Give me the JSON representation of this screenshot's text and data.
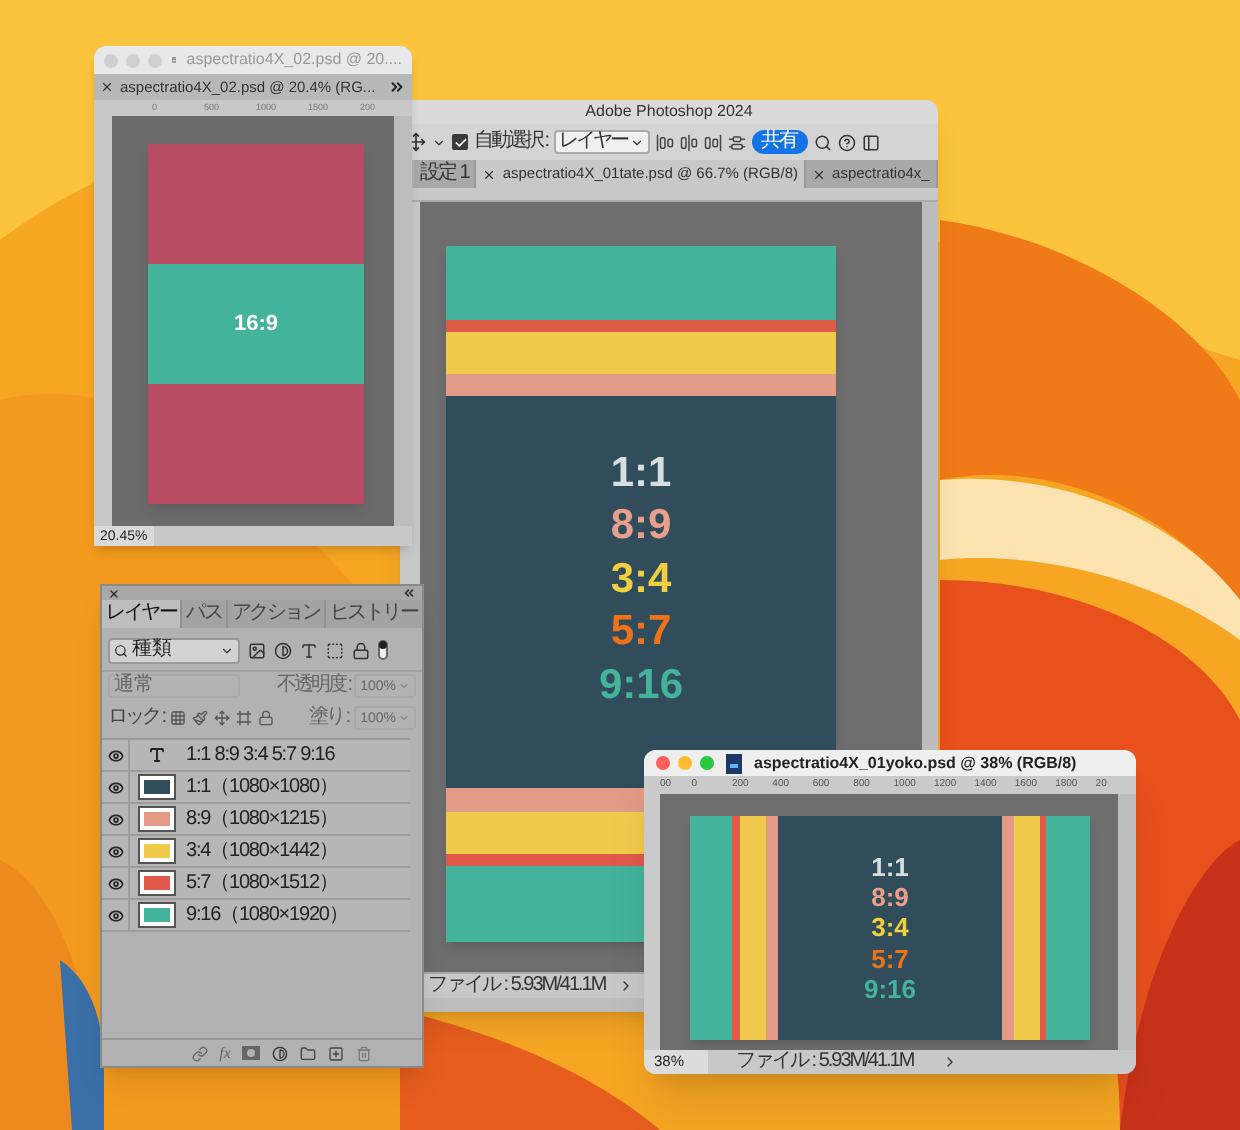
{
  "window_02": {
    "active": false,
    "title": "aspectratio4X_02.psd @ 20....",
    "tab": {
      "label": "aspectratio4X_02.psd @ 20.4% (RG...",
      "selected": true
    },
    "ruler": [
      "0",
      "500",
      "1000",
      "1500",
      "200"
    ],
    "bands": [
      {
        "color": "#b84c62"
      },
      {
        "color": "#44b39b",
        "label": "16:9"
      },
      {
        "color": "#b84c62"
      }
    ],
    "zoom": "20.45%"
  },
  "photoshop_window": {
    "title": "Adobe Photoshop 2024",
    "auto_select": {
      "label": "自動選択 :",
      "checked": true
    },
    "target": "レイヤー",
    "share_button": "共有",
    "tabs": [
      {
        "label": "設定 1",
        "selected": false
      },
      {
        "label": "aspectratio4X_01tate.psd @ 66.7% (RGB/8)",
        "selected": true
      },
      {
        "label": "aspectratio4x_",
        "selected": false
      }
    ],
    "stripes_top": [
      {
        "color": "#44b39b"
      },
      {
        "color": "#e05a4a"
      },
      {
        "color": "#f0cb4b"
      },
      {
        "color": "#e39a87"
      }
    ],
    "ratios": [
      {
        "text": "1:1",
        "color": "#d8dde0"
      },
      {
        "text": "8:9",
        "color": "#e8a08c"
      },
      {
        "text": "3:4",
        "color": "#f2cf3f"
      },
      {
        "text": "5:7",
        "color": "#ee7318"
      },
      {
        "text": "9:16",
        "color": "#44b39b"
      }
    ],
    "stripes_bottom": [
      {
        "color": "#e39a87"
      },
      {
        "color": "#f0cb4b"
      },
      {
        "color": "#e05a4a"
      },
      {
        "color": "#44b39b"
      }
    ],
    "file_info": "ファイル : 5.93M/41.1M"
  },
  "layers_panel": {
    "tabs": [
      {
        "label": "レイヤー",
        "selected": true
      },
      {
        "label": "パス",
        "selected": false
      },
      {
        "label": "アクション",
        "selected": false
      },
      {
        "label": "ヒストリー",
        "selected": false
      }
    ],
    "filter": "種類",
    "blend_mode": {
      "value": "通常",
      "disabled": true
    },
    "opacity": {
      "label": "不透明度 :",
      "value": "100%",
      "disabled": true
    },
    "lock_label": "ロック :",
    "fill": {
      "label": "塗り :",
      "value": "100%",
      "disabled": true
    },
    "layers": [
      {
        "kind": "text",
        "name": "1:1 8:9 3:4 5:7 9:16",
        "visible": true
      },
      {
        "kind": "pixel",
        "name": "1:1（1080×1080）",
        "color": "#314c5a",
        "visible": true
      },
      {
        "kind": "pixel",
        "name": "8:9（1080×1215）",
        "color": "#e39a87",
        "visible": true
      },
      {
        "kind": "pixel",
        "name": "3:4（1080×1442）",
        "color": "#f0cb4b",
        "visible": true
      },
      {
        "kind": "pixel",
        "name": "5:7（1080×1512）",
        "color": "#e05a4a",
        "visible": true
      },
      {
        "kind": "pixel",
        "name": "9:16（1080×1920）",
        "color": "#44b39b",
        "visible": true
      }
    ],
    "effects_label": "fx"
  },
  "window_yoko": {
    "active": true,
    "title": "aspectratio4X_01yoko.psd @ 38% (RGB/8)",
    "ruler": [
      "00",
      "0",
      "200",
      "400",
      "600",
      "800",
      "1000",
      "1200",
      "1400",
      "1600",
      "1800",
      "20"
    ],
    "stripes_left": [
      {
        "color": "#44b39b"
      },
      {
        "color": "#e05a4a"
      },
      {
        "color": "#f0cb4b"
      },
      {
        "color": "#e39a87"
      }
    ],
    "ratios": [
      {
        "text": "1:1",
        "color": "#d8dde0"
      },
      {
        "text": "8:9",
        "color": "#e8a08c"
      },
      {
        "text": "3:4",
        "color": "#f2cf3f"
      },
      {
        "text": "5:7",
        "color": "#ee7318"
      },
      {
        "text": "9:16",
        "color": "#44b39b"
      }
    ],
    "stripes_right": [
      {
        "color": "#e39a87"
      },
      {
        "color": "#f0cb4b"
      },
      {
        "color": "#e05a4a"
      },
      {
        "color": "#44b39b"
      }
    ],
    "zoom": "38%",
    "file_info": "ファイル : 5.93M/41.1M"
  }
}
